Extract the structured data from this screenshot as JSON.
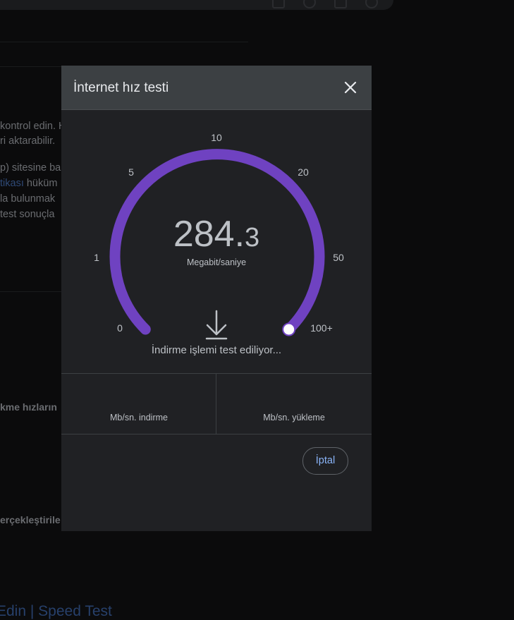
{
  "background": {
    "lines": [
      "kontrol edin. H",
      "ri aktarabilir.",
      "p) sitesine ba",
      "tikası",
      " hüküm",
      "la bulunmak",
      " test sonuçla"
    ],
    "bold_1": "kme hızların",
    "bold_2": "erçekleştirile",
    "heading": "Edin | Speed Test"
  },
  "dialog": {
    "title": "İnternet hız testi",
    "gauge": {
      "ticks": [
        "0",
        "1",
        "5",
        "10",
        "20",
        "50",
        "100+"
      ],
      "speed_integer": "284.",
      "speed_decimal": "3",
      "unit": "Megabit/saniye",
      "progress_fraction": 1.0,
      "arc_color": "#6f42c1"
    },
    "status": "İndirme işlemi test ediliyor...",
    "download_label": "Mb/sn. indirme",
    "upload_label": "Mb/sn. yükleme",
    "cancel_label": "İptal"
  },
  "colors": {
    "accent": "#8ab4f8",
    "arc": "#6f42c1"
  }
}
